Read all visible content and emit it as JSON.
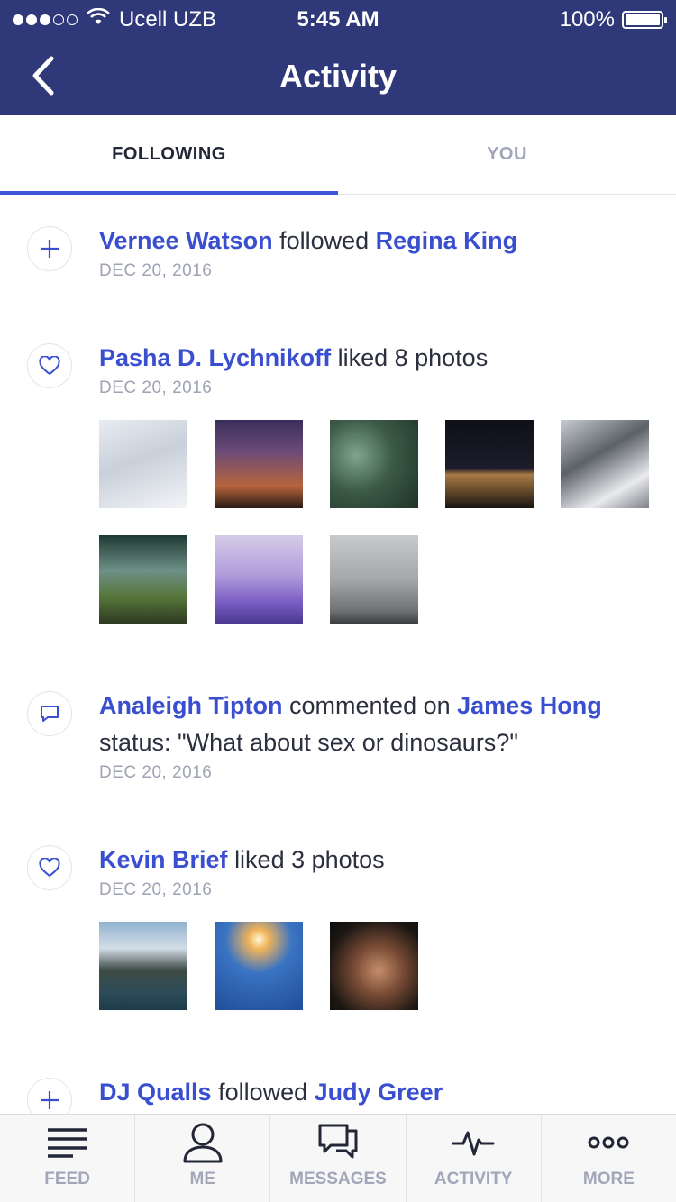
{
  "status_bar": {
    "carrier": "Ucell UZB",
    "time": "5:45 AM",
    "battery": "100%",
    "signal_filled": 3,
    "signal_total": 5,
    "battery_level": 1.0
  },
  "nav": {
    "title": "Activity",
    "back_icon": "chevron-left-icon"
  },
  "tabs": [
    {
      "label": "FOLLOWING",
      "active": true
    },
    {
      "label": "YOU",
      "active": false
    }
  ],
  "feed": [
    {
      "type": "follow",
      "icon": "plus-icon",
      "actor": "Vernee Watson",
      "verb": "followed",
      "target": "Regina King",
      "date": "DEC 20, 2016"
    },
    {
      "type": "like",
      "icon": "heart-icon",
      "actor": "Pasha D. Lychnikoff",
      "verb": "liked 8 photos",
      "date": "DEC 20, 2016",
      "photos": [
        "frosty-plants",
        "milky-way-person",
        "succulents",
        "boathouse-night",
        "snowy-mountain",
        "green-valley",
        "purple-sea",
        "foggy-bridge"
      ]
    },
    {
      "type": "comment",
      "icon": "comment-icon",
      "actor": "Analeigh Tipton",
      "verb": "commented on",
      "target": "James Hong",
      "text": "status: \"What about sex or dinosaurs?\"",
      "date": "DEC 20, 2016"
    },
    {
      "type": "like",
      "icon": "heart-icon",
      "actor": "Kevin Brief",
      "verb": "liked 3 photos",
      "date": "DEC 20, 2016",
      "photos": [
        "rock-island",
        "lighthouse",
        "old-man-portrait"
      ]
    },
    {
      "type": "follow",
      "icon": "plus-icon",
      "actor": "DJ Qualls",
      "verb": "followed",
      "target": "Judy Greer"
    }
  ],
  "tabbar": [
    {
      "label": "FEED",
      "icon": "feed-lines-icon"
    },
    {
      "label": "ME",
      "icon": "user-icon"
    },
    {
      "label": "MESSAGES",
      "icon": "messages-icon"
    },
    {
      "label": "ACTIVITY",
      "icon": "activity-pulse-icon"
    },
    {
      "label": "MORE",
      "icon": "more-dots-icon"
    }
  ],
  "colors": {
    "header": "#2f3878",
    "accent": "#3a4fd0",
    "muted": "#9fa3b3",
    "text": "#2c2f3e"
  }
}
